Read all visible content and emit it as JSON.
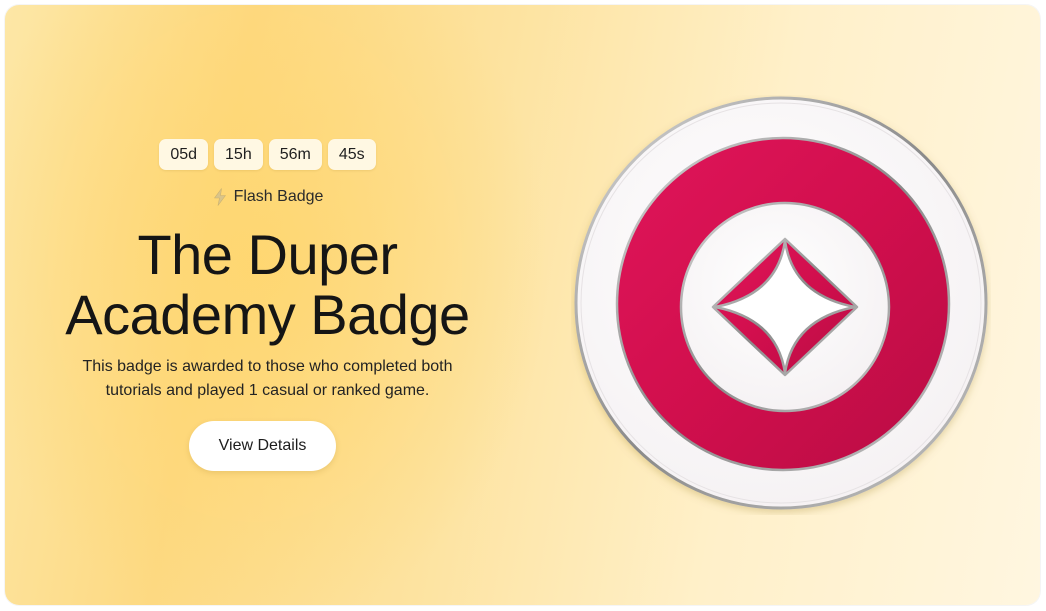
{
  "countdown": {
    "days": "05d",
    "hours": "15h",
    "minutes": "56m",
    "seconds": "45s"
  },
  "badge_type": {
    "icon": "lightning-icon",
    "label": "Flash Badge"
  },
  "title": {
    "line1": "The Duper",
    "line2": "Academy Badge"
  },
  "description": "This badge is awarded to those who completed both tutorials and played 1 casual or ranked game.",
  "cta": {
    "label": "View Details"
  },
  "badge_image": {
    "icon": "star-diamond-badge-icon",
    "colors": {
      "ring": "#d4104f",
      "white": "#ffffff",
      "metal": "#9a9a9a"
    }
  },
  "colors": {
    "background_warm": "#fdd982",
    "background_light": "#fff6e0",
    "text": "#151515"
  }
}
